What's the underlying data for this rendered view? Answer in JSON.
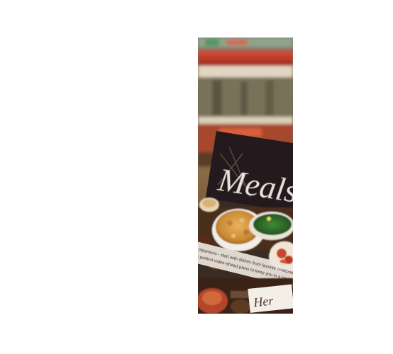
{
  "photo": {
    "magazine_title": "Meals Th",
    "cover_caption_lines": [
      "...mpanions - start with dishes from favorite cookbooks",
      "...s perfect make-ahead plans to keep you in a savory mood"
    ],
    "corner_label": "Her",
    "colors": {
      "shelf_red": "#c23a2a",
      "cover_dark": "#241a1e",
      "title_silver": "#e6e2dc",
      "casserole_gold": "#d99a3e",
      "greens": "#2f6b2a",
      "tomato": "#c8472b"
    }
  }
}
